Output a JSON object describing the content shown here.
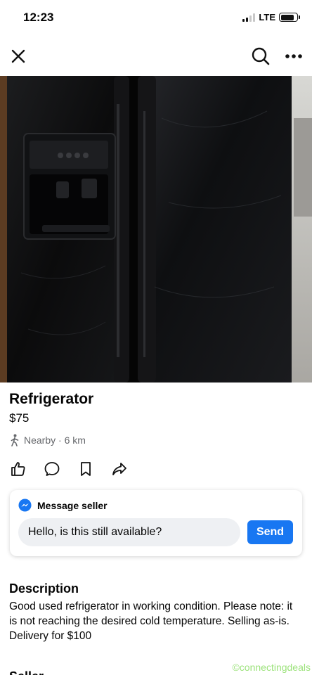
{
  "status_bar": {
    "time": "12:23",
    "network": "LTE"
  },
  "nav": {
    "close_icon": "close-icon",
    "search_icon": "search-icon",
    "more_icon": "more-icon"
  },
  "listing": {
    "title": "Refrigerator",
    "price": "$75",
    "location": "Nearby · 6 km"
  },
  "actions": [
    "like-icon",
    "comment-icon",
    "save-icon",
    "share-icon"
  ],
  "message": {
    "header": "Message seller",
    "input_value": "Hello, is this still available?",
    "send_label": "Send"
  },
  "description": {
    "heading": "Description",
    "body": "Good used refrigerator in working condition. Please note: it is not reaching the desired cold temperature. Selling as-is. Delivery for $100"
  },
  "seller_heading_partial": "Seller",
  "watermark": "©connectingdeals",
  "colors": {
    "accent": "#1877f2",
    "secondary_text": "#65676b",
    "input_bg": "#eef0f3",
    "watermark": "#9be27a"
  }
}
